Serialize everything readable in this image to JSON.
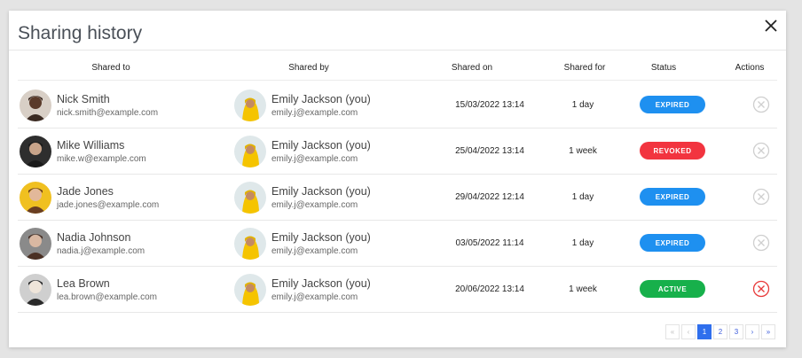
{
  "dialog": {
    "title": "Sharing history",
    "close_label": "✕"
  },
  "columns": {
    "shared_to": "Shared to",
    "shared_by": "Shared by",
    "shared_on": "Shared on",
    "shared_for": "Shared for",
    "status": "Status",
    "actions": "Actions"
  },
  "rows": [
    {
      "to_name": "Nick Smith",
      "to_email": "nick.smith@example.com",
      "by_name": "Emily Jackson (you)",
      "by_email": "emily.j@example.com",
      "shared_on": "15/03/2022 13:14",
      "shared_for": "1 day",
      "status": "EXPIRED",
      "status_color": "#1e90f0",
      "action_active": false
    },
    {
      "to_name": "Mike Williams",
      "to_email": "mike.w@example.com",
      "by_name": "Emily Jackson (you)",
      "by_email": "emily.j@example.com",
      "shared_on": "25/04/2022 13:14",
      "shared_for": "1 week",
      "status": "REVOKED",
      "status_color": "#f2343f",
      "action_active": false
    },
    {
      "to_name": "Jade Jones",
      "to_email": "jade.jones@example.com",
      "by_name": "Emily Jackson (you)",
      "by_email": "emily.j@example.com",
      "shared_on": "29/04/2022 12:14",
      "shared_for": "1 day",
      "status": "EXPIRED",
      "status_color": "#1e90f0",
      "action_active": false
    },
    {
      "to_name": "Nadia Johnson",
      "to_email": "nadia.j@example.com",
      "by_name": "Emily Jackson (you)",
      "by_email": "emily.j@example.com",
      "shared_on": "03/05/2022 11:14",
      "shared_for": "1 day",
      "status": "EXPIRED",
      "status_color": "#1e90f0",
      "action_active": false
    },
    {
      "to_name": "Lea Brown",
      "to_email": "lea.brown@example.com",
      "by_name": "Emily Jackson (you)",
      "by_email": "emily.j@example.com",
      "shared_on": "20/06/2022 13:14",
      "shared_for": "1 week",
      "status": "ACTIVE",
      "status_color": "#17b04b",
      "action_active": true
    }
  ],
  "pagination": {
    "first": "«",
    "prev": "‹",
    "pages": [
      "1",
      "2",
      "3"
    ],
    "current": "1",
    "next": "›",
    "last": "»"
  },
  "colors": {
    "expired": "#1e90f0",
    "revoked": "#f2343f",
    "active": "#17b04b",
    "revoke_enabled": "#e83a3a",
    "revoke_disabled": "#cfcfcf",
    "pager_active": "#2f6fed"
  },
  "icons": {
    "close": "close-icon",
    "revoke": "circle-x-icon"
  }
}
